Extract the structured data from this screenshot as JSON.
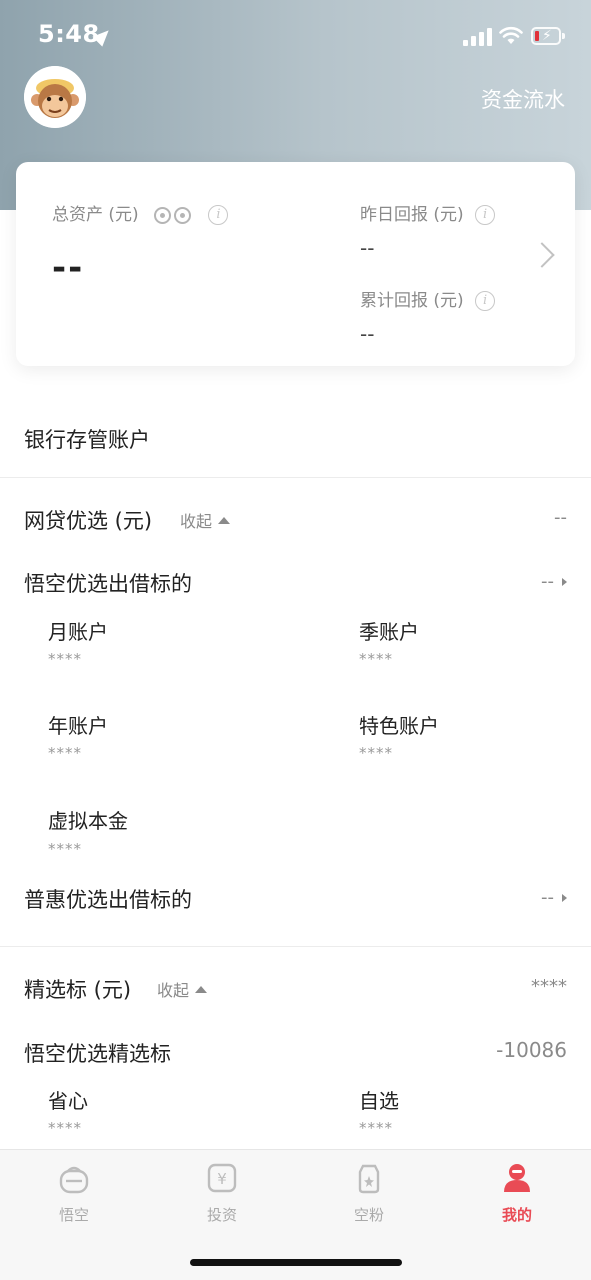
{
  "status_bar": {
    "time": "5:48"
  },
  "header": {
    "funds_link": "资金流水"
  },
  "summary": {
    "total_assets_label": "总资产 (元)",
    "total_assets_value": "--",
    "yesterday_label": "昨日回报 (元)",
    "yesterday_value": "--",
    "cumulative_label": "累计回报 (元)",
    "cumulative_value": "--"
  },
  "bank_account": "银行存管账户",
  "loan_section": {
    "title": "网贷优选 (元)",
    "collapse": "收起",
    "value": "--",
    "groups": [
      {
        "title": "悟空优选出借标的",
        "value": "--"
      },
      {
        "title": "普惠优选出借标的",
        "value": "--"
      }
    ],
    "accounts": [
      {
        "name": "月账户",
        "value": "****"
      },
      {
        "name": "季账户",
        "value": "****"
      },
      {
        "name": "年账户",
        "value": "****"
      },
      {
        "name": "特色账户",
        "value": "****"
      },
      {
        "name": "虚拟本金",
        "value": "****"
      }
    ]
  },
  "select_section": {
    "title": "精选标 (元)",
    "collapse": "收起",
    "value": "****",
    "group_title": "悟空优选精选标",
    "group_value": "-10086",
    "accounts": [
      {
        "name": "省心",
        "value": "****"
      },
      {
        "name": "自选",
        "value": "****"
      }
    ]
  },
  "tabbar": {
    "items": [
      {
        "label": "悟空",
        "icon": "wukong-icon"
      },
      {
        "label": "投资",
        "icon": "invest-icon"
      },
      {
        "label": "空粉",
        "icon": "fans-icon"
      },
      {
        "label": "我的",
        "icon": "profile-icon"
      }
    ],
    "active_color": "#e94b55"
  }
}
